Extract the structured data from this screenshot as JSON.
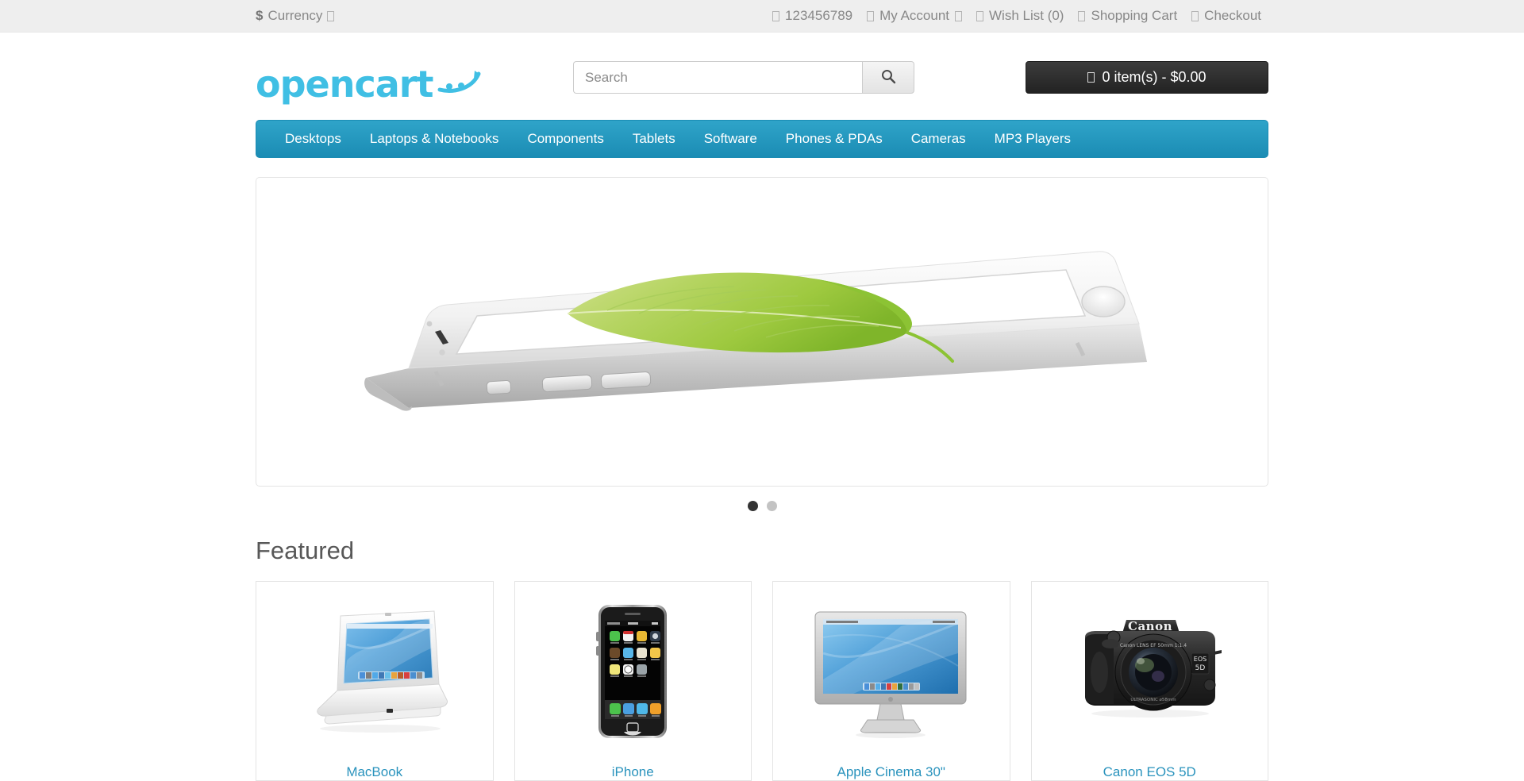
{
  "topbar": {
    "currency": {
      "symbol": "$",
      "label": "Currency",
      "caret_icon": "missing-glyph-box"
    },
    "links": [
      {
        "name": "telephone",
        "icon": "phone-icon",
        "label": "123456789"
      },
      {
        "name": "my-account",
        "icon": "user-icon",
        "label": "My Account",
        "caret_icon": "missing-glyph-box"
      },
      {
        "name": "wish-list",
        "icon": "heart-icon",
        "label": "Wish List (0)"
      },
      {
        "name": "shopping-cart",
        "icon": "cart-icon",
        "label": "Shopping Cart"
      },
      {
        "name": "checkout",
        "icon": "share-icon",
        "label": "Checkout"
      }
    ]
  },
  "header": {
    "logo_text": "opencart",
    "logo_icon": "cart-swoosh-icon",
    "search": {
      "placeholder": "Search",
      "value": "",
      "button_icon": "search-icon"
    },
    "cart": {
      "icon": "cart-icon",
      "label": "0 item(s) - $0.00",
      "items": 0,
      "total": "$0.00"
    }
  },
  "nav": {
    "items": [
      {
        "label": "Desktops"
      },
      {
        "label": "Laptops & Notebooks"
      },
      {
        "label": "Components"
      },
      {
        "label": "Tablets"
      },
      {
        "label": "Software"
      },
      {
        "label": "Phones & PDAs"
      },
      {
        "label": "Cameras"
      },
      {
        "label": "MP3 Players"
      }
    ]
  },
  "carousel": {
    "slides": [
      {
        "name": "iphone6-banner",
        "alt": "Silver smartphone lying flat with a green leaf on screen",
        "active": true
      },
      {
        "name": "second-banner",
        "alt": "",
        "active": false
      }
    ],
    "indicator_count": 2,
    "active_index": 0
  },
  "featured": {
    "heading": "Featured",
    "products": [
      {
        "name": "macbook",
        "title": "MacBook",
        "image": "white-laptop-with-blue-wallpaper"
      },
      {
        "name": "iphone",
        "title": "iPhone",
        "image": "black-smartphone-home-screen"
      },
      {
        "name": "apple-cinema-30",
        "title": "Apple Cinema 30\"",
        "image": "silver-widescreen-monitor"
      },
      {
        "name": "canon-eos-5d",
        "title": "Canon EOS 5D",
        "image": "black-dslr-camera"
      }
    ]
  },
  "colors": {
    "brand_cyan": "#40bfe4",
    "nav_blue": "#1b8cb4",
    "topbar_grey": "#eeeeee",
    "link_blue": "#2a93bd",
    "cart_dark": "#222222"
  }
}
